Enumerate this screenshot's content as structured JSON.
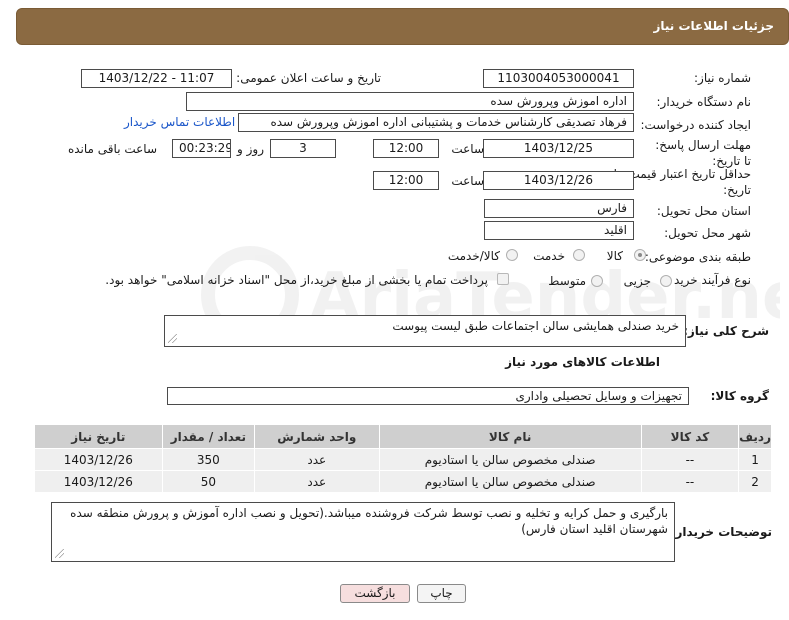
{
  "header": {
    "title": "جزئیات اطلاعات نیاز"
  },
  "form": {
    "need_number_label": "شماره نیاز:",
    "need_number": "1103004053000041",
    "announce_label": "تاریخ و ساعت اعلان عمومی:",
    "announce_value": "1403/12/22 - 11:07",
    "buyer_org_label": "نام دستگاه خریدار:",
    "buyer_org": "اداره اموزش وپرورش سده",
    "creator_label": "ایجاد کننده درخواست:",
    "creator": "فرهاد تصدیقی کارشناس خدمات و پشتیبانی اداره اموزش وپرورش سده",
    "buyer_contact_link": "اطلاعات تماس خریدار",
    "reply_deadline_label": "مهلت ارسال پاسخ: تا تاریخ:",
    "reply_date": "1403/12/25",
    "time_label": "ساعت",
    "reply_time": "12:00",
    "days_value": "3",
    "days_label": "روز و",
    "remaining_value": "00:23:29",
    "remaining_label": "ساعت باقی مانده",
    "price_validity_label": "حداقل تاریخ اعتبار قیمت: تا تاریخ:",
    "price_date": "1403/12/26",
    "price_time": "12:00",
    "province_label": "استان محل تحویل:",
    "province": "فارس",
    "city_label": "شهر محل تحویل:",
    "city": "اقلید",
    "category_label": "طبقه بندی موضوعی:",
    "category_options": [
      "کالا",
      "خدمت",
      "کالا/خدمت"
    ],
    "category_selected": "کالا",
    "process_label": "نوع فرآیند خرید :",
    "process_options": [
      "جزیی",
      "متوسط"
    ],
    "payment_note": "پرداخت تمام یا بخشی از مبلغ خرید،از محل \"اسناد خزانه اسلامی\" خواهد بود."
  },
  "description": {
    "label": "شرح کلی نیاز:",
    "value": "خرید صندلی همایشی سالن اجتماعات طبق لیست پیوست"
  },
  "goods_section": {
    "title": "اطلاعات کالاهای مورد نیاز",
    "group_label": "گروه کالا:",
    "group_value": "تجهیزات و وسایل تحصیلی واداری"
  },
  "items_table": {
    "headers": [
      "ردیف",
      "کد کالا",
      "نام کالا",
      "واحد شمارش",
      "تعداد / مقدار",
      "تاریخ نیاز"
    ],
    "rows": [
      [
        "1",
        "--",
        "صندلی مخصوص سالن یا استادیوم",
        "عدد",
        "350",
        "1403/12/26"
      ],
      [
        "2",
        "--",
        "صندلی مخصوص سالن یا استادیوم",
        "عدد",
        "50",
        "1403/12/26"
      ]
    ]
  },
  "buyer_notes": {
    "label": "توضیحات خریدار:",
    "value": "بارگیری و حمل کرایه و تخلیه و نصب توسط شرکت فروشنده میباشد.(تحویل و نصب اداره آموزش و پرورش منطقه سده شهرستان اقلید استان فارس)"
  },
  "buttons": {
    "print": "چاپ",
    "back": "بازگشت"
  },
  "watermark": {
    "text": "AriaTender.net"
  },
  "colors": {
    "header_bg": "#8b6a42",
    "link": "#1a56c9",
    "back_button_bg": "#f6dede"
  }
}
